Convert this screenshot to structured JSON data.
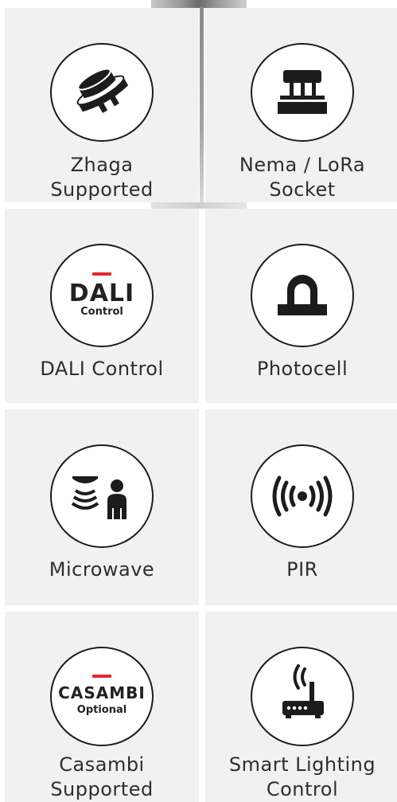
{
  "features": [
    {
      "id": "zhaga",
      "icon": "zhaga-connector-icon",
      "label_lines": [
        "Zhaga",
        "Supported"
      ]
    },
    {
      "id": "nema",
      "icon": "nema-socket-icon",
      "label_lines": [
        "Nema / LoRa",
        "Socket"
      ]
    },
    {
      "id": "dali",
      "icon": "dali-logo-icon",
      "logo_word": "DALI",
      "logo_sub": "Control",
      "label_lines": [
        "DALI Control"
      ]
    },
    {
      "id": "photocell",
      "icon": "photocell-icon",
      "label_lines": [
        "Photocell"
      ]
    },
    {
      "id": "microwave",
      "icon": "microwave-sensor-icon",
      "label_lines": [
        "Microwave"
      ]
    },
    {
      "id": "pir",
      "icon": "pir-signal-icon",
      "label_lines": [
        "PIR"
      ]
    },
    {
      "id": "casambi",
      "icon": "casambi-logo-icon",
      "logo_word": "CASAMBI",
      "logo_sub": "Optional",
      "label_lines": [
        "Casambi",
        "Supported"
      ]
    },
    {
      "id": "smart",
      "icon": "router-wifi-icon",
      "label_lines": [
        "Smart Lighting",
        "Control"
      ]
    }
  ],
  "colors": {
    "card_bg": "#f1f1f1",
    "icon": "#1c1c1c",
    "accent_red": "#e0262d",
    "text": "#2e2e2e"
  }
}
